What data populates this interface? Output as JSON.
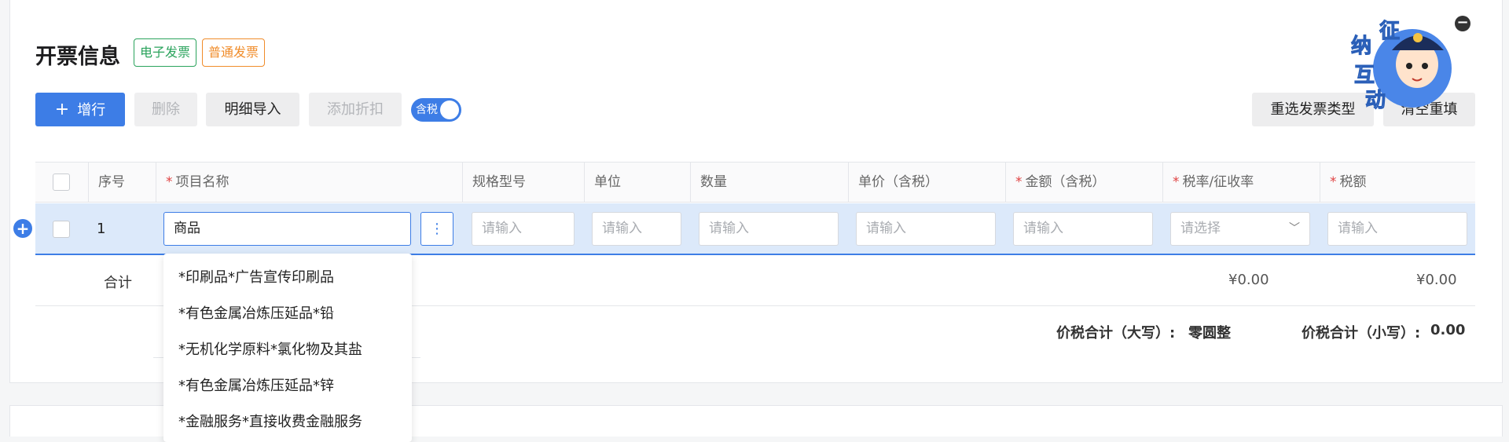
{
  "section": {
    "title": "开票信息",
    "tag_electronic": "电子发票",
    "tag_normal": "普通发票"
  },
  "toolbar": {
    "add_row": "增行",
    "delete": "删除",
    "detail_import": "明细导入",
    "add_discount": "添加折扣",
    "tax_toggle": "含税",
    "reselect_type": "重选发票类型",
    "clear_refill": "清空重填"
  },
  "mascot": {
    "text": "征纳互动"
  },
  "table": {
    "headers": {
      "seq": "序号",
      "item_name": "项目名称",
      "spec": "规格型号",
      "unit": "单位",
      "qty": "数量",
      "unit_price": "单价（含税）",
      "amount": "金额（含税）",
      "tax_rate": "税率/征收率",
      "tax": "税额"
    },
    "row": {
      "seq": "1",
      "item_name_value": "商品",
      "placeholder_input": "请输入",
      "placeholder_select": "请选择"
    },
    "summary": {
      "label": "合计",
      "amount_total": "¥0.00",
      "tax_total": "¥0.00"
    },
    "totals": {
      "upper_label": "价税合计（大写）:",
      "upper_value": "零圆整",
      "lower_label": "价税合计（小写）:",
      "lower_value": "0.00"
    }
  },
  "dropdown": {
    "items": [
      "*印刷品*广告宣传印刷品",
      "*有色金属冶炼压延品*铅",
      "*无机化学原料*氯化物及其盐",
      "*有色金属冶炼压延品*锌",
      "*金融服务*直接收费金融服务"
    ]
  },
  "colors": {
    "primary": "#3d7de6",
    "tag_green": "#2aa35c",
    "tag_orange": "#f08c2a",
    "required": "#e04343"
  }
}
